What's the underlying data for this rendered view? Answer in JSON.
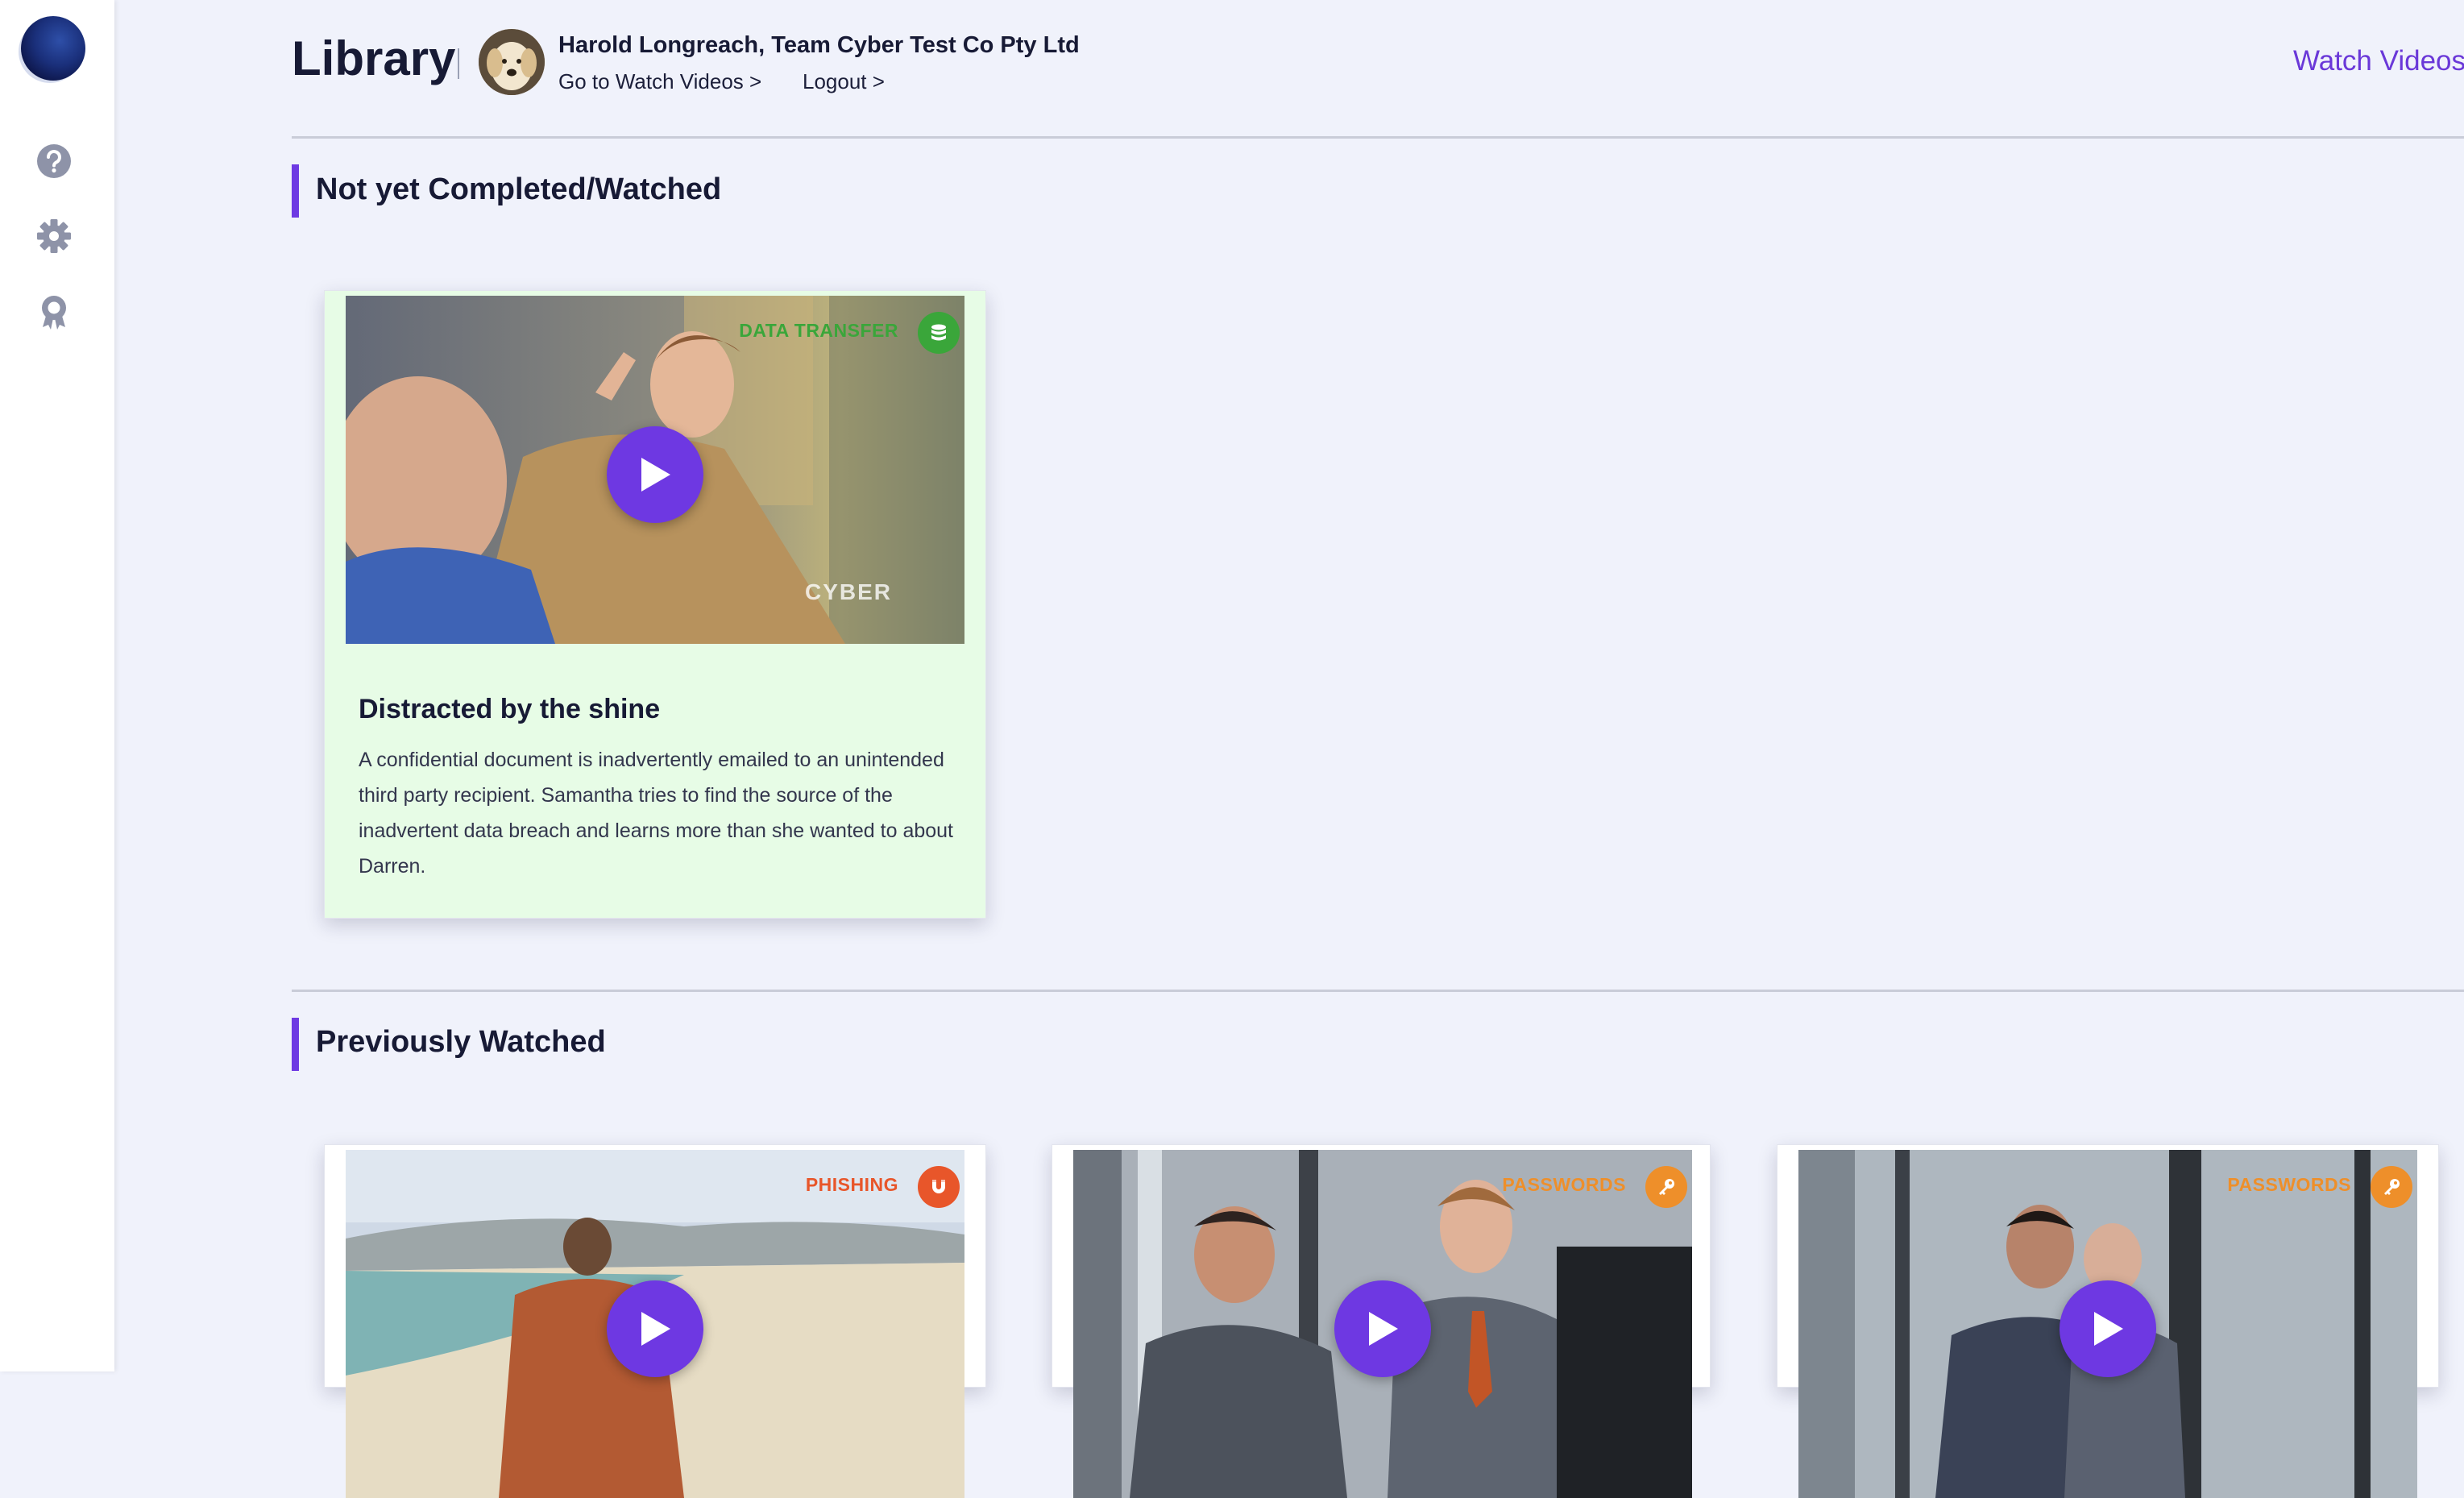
{
  "sidebar": {
    "icons": [
      "logo-icon",
      "help-icon",
      "gear-icon",
      "award-icon"
    ]
  },
  "header": {
    "title": "Library",
    "user_name": "Harold Longreach, Team Cyber Test Co Pty Ltd",
    "link_watch": "Go to Watch Videos >",
    "link_logout": "Logout >",
    "watch_videos": "Watch Videos"
  },
  "sections": {
    "not_completed": {
      "title": "Not yet Completed/Watched",
      "cards": [
        {
          "category": "DATA TRANSFER",
          "category_color": "#3aa63a",
          "icon": "database-icon",
          "title": "Distracted by the shine",
          "description": "A confidential document is inadvertently emailed to an unintended third party recipient. Samantha tries to find the source of the inadvertent data breach and learns more than she wanted to about Darren.",
          "watermark": "CYBER"
        }
      ]
    },
    "previously_watched": {
      "title": "Previously Watched",
      "cards": [
        {
          "category": "PHISHING",
          "category_color": "#e8562a",
          "icon": "magnet-icon"
        },
        {
          "category": "PASSWORDS",
          "category_color": "#ee8f2a",
          "icon": "key-icon"
        },
        {
          "category": "PASSWORDS",
          "category_color": "#ee8f2a",
          "icon": "key-icon"
        }
      ]
    }
  },
  "colors": {
    "accent": "#6e3ae3",
    "background": "#f0f2fb",
    "card_highlight": "#e7fce6"
  }
}
